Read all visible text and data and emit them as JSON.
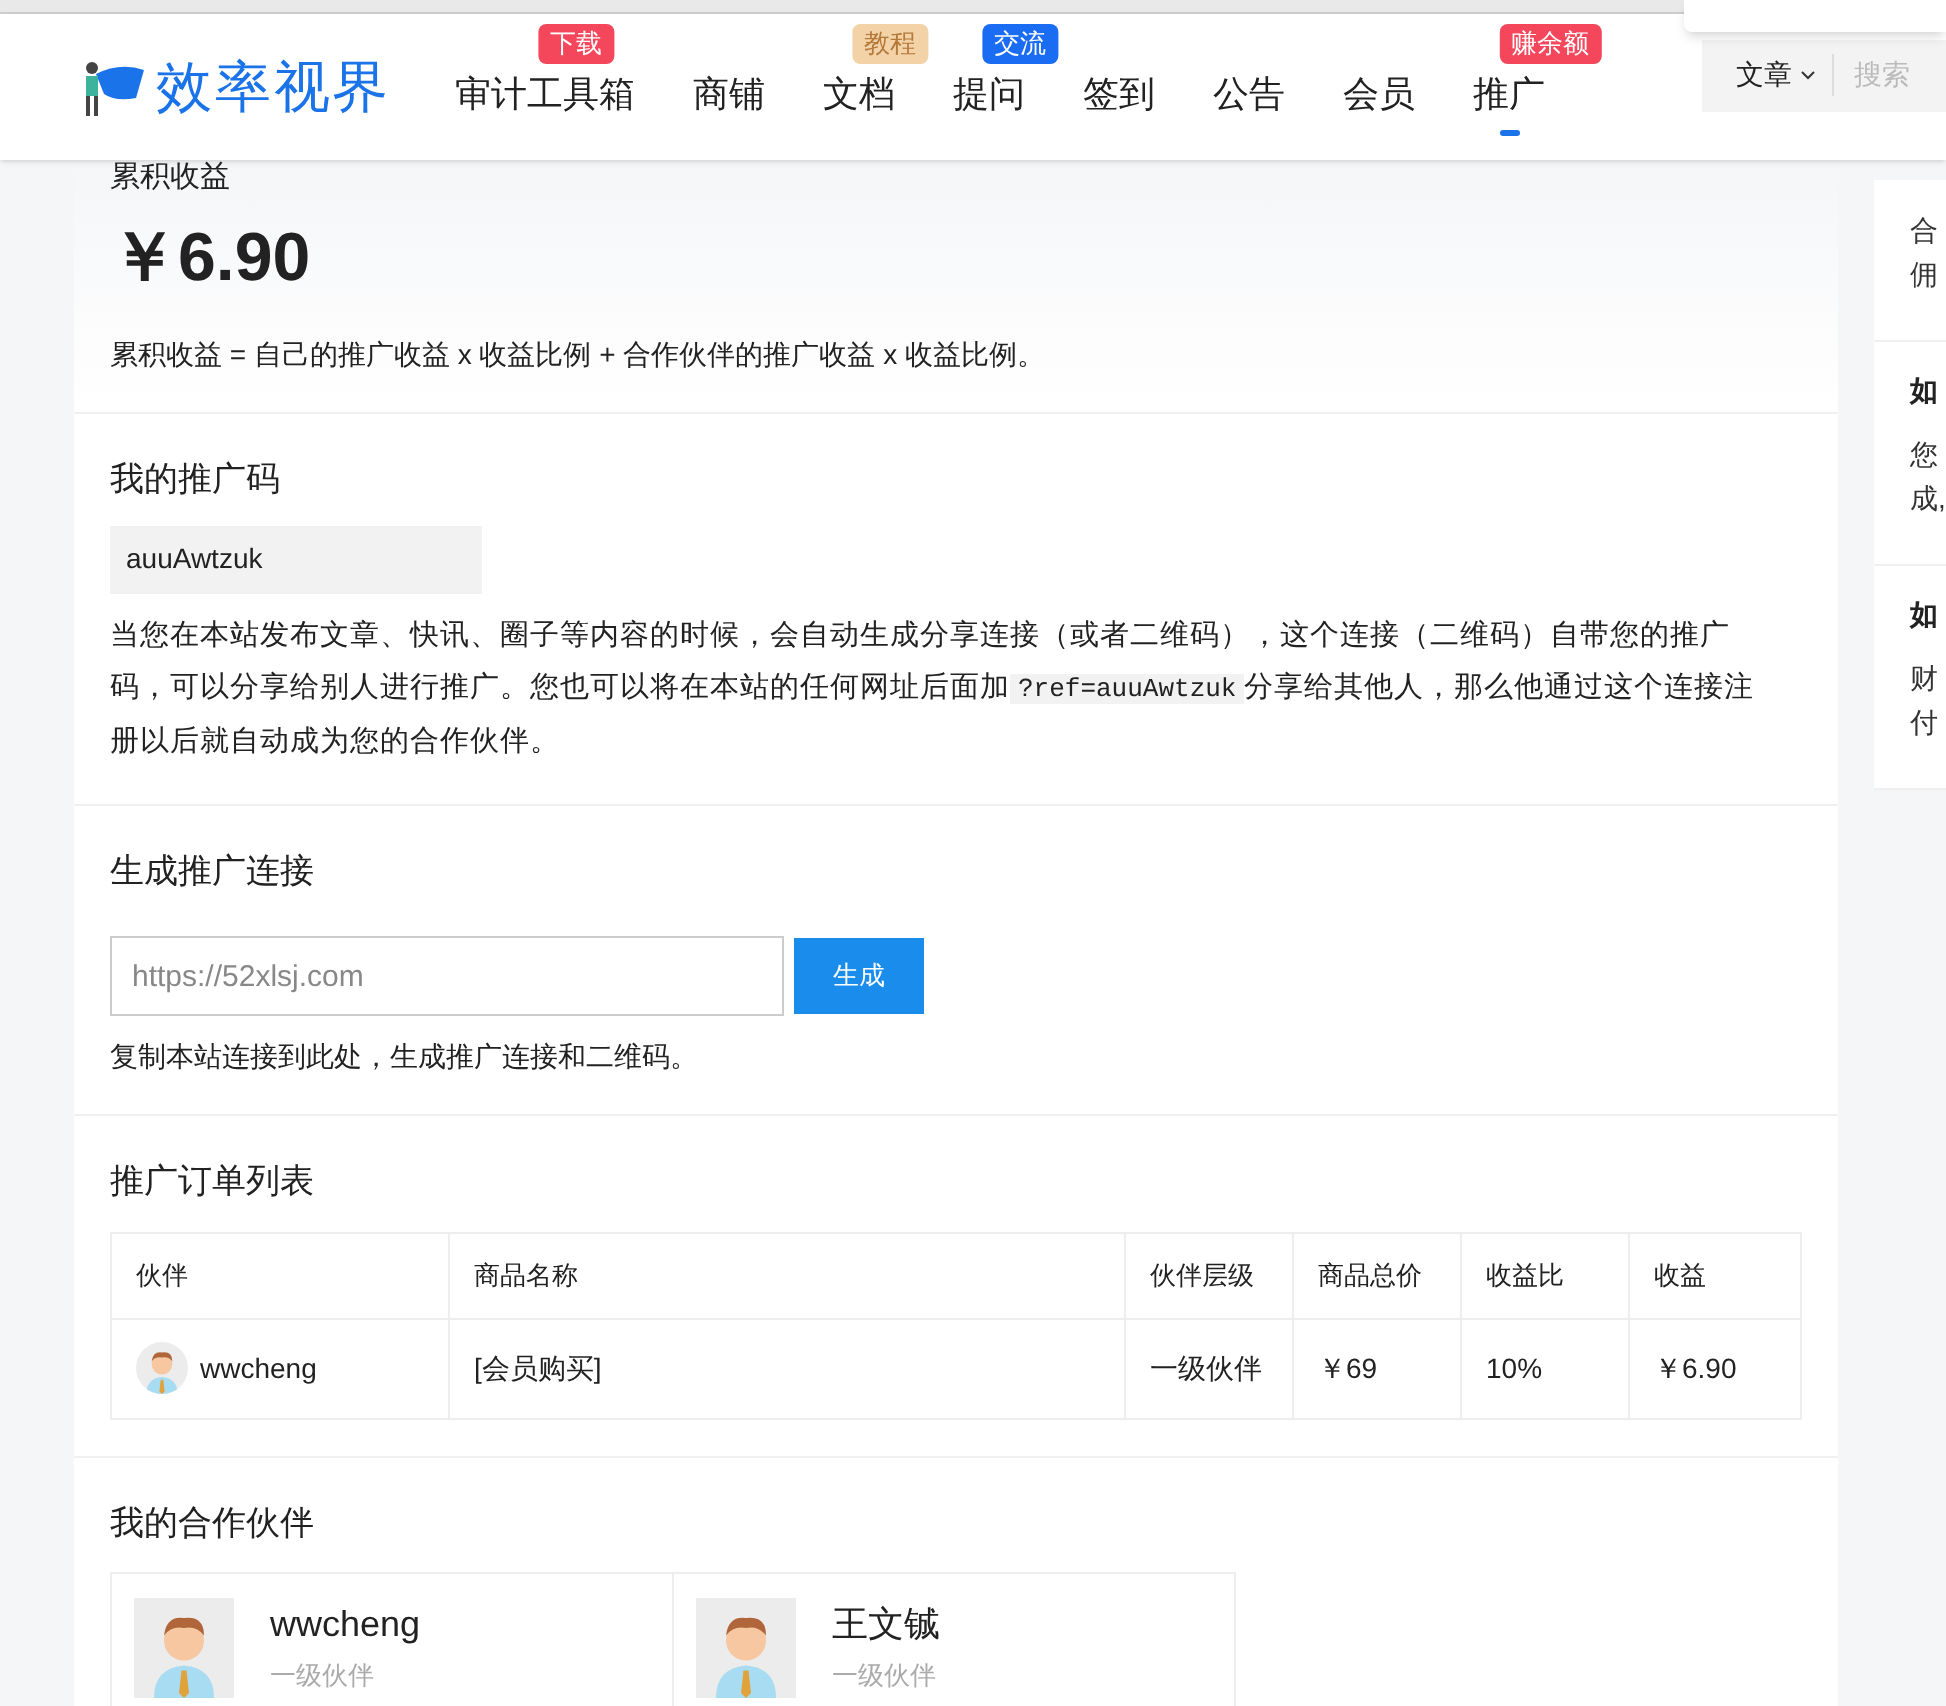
{
  "header": {
    "logo": "效率视界",
    "nav": [
      {
        "label": "审计工具箱",
        "badge": "下载",
        "color": "#f5475b",
        "selected": false
      },
      {
        "label": "商铺",
        "selected": false
      },
      {
        "label": "文档",
        "badge": "教程",
        "color": "#f3d2a7",
        "selected": false
      },
      {
        "label": "提问",
        "badge": "交流",
        "color": "#1a6cf2",
        "selected": false
      },
      {
        "label": "签到",
        "selected": false
      },
      {
        "label": "公告",
        "selected": false
      },
      {
        "label": "会员",
        "selected": false
      },
      {
        "label": "推广",
        "badge": "赚余额",
        "color": "#f5475b",
        "selected": true
      }
    ],
    "search_scope": "文章",
    "search": {
      "placeholder": "搜索"
    }
  },
  "earnings": {
    "title": "累积收益",
    "amount": "￥6.90",
    "formula": "累积收益 = 自己的推广收益 x 收益比例 + 合作伙伴的推广收益 x 收益比例。"
  },
  "promo_code": {
    "title": "我的推广码",
    "code": "auuAwtzuk",
    "text_before": "当您在本站发布文章、快讯、圈子等内容的时候，会自动生成分享连接（或者二维码），这个连接（二维码）自带您的推广码，可以分享给别人进行推广。您也可以将在本站的任何网址后面加",
    "code_snippet": "?ref=auuAwtzuk",
    "text_after": "分享给其他人，那么他通过这个连接注册以后就自动成为您的合作伙伴。"
  },
  "generate": {
    "title": "生成推广连接",
    "input": {
      "placeholder": "https://52xlsj.com"
    },
    "button": "生成",
    "hint": "复制本站连接到此处，生成推广连接和二维码。"
  },
  "orders": {
    "title": "推广订单列表",
    "columns": [
      "伙伴",
      "商品名称",
      "伙伴层级",
      "商品总价",
      "收益比",
      "收益"
    ],
    "rows": [
      {
        "partner": "wwcheng",
        "product": "[会员购买]",
        "level": "一级伙伴",
        "price": "￥69",
        "ratio": "10%",
        "income": "￥6.90"
      }
    ]
  },
  "partners": {
    "title": "我的合作伙伴",
    "items": [
      {
        "name": "wwcheng",
        "level": "一级伙伴"
      },
      {
        "name": "王文铖",
        "level": "一级伙伴"
      }
    ]
  },
  "sidebar": {
    "cards": [
      {
        "lines": [
          "合",
          "佣"
        ]
      },
      {
        "heading": "如",
        "lines": [
          "您",
          "成,"
        ]
      },
      {
        "heading": "如",
        "lines": [
          "财",
          "付"
        ]
      }
    ]
  }
}
